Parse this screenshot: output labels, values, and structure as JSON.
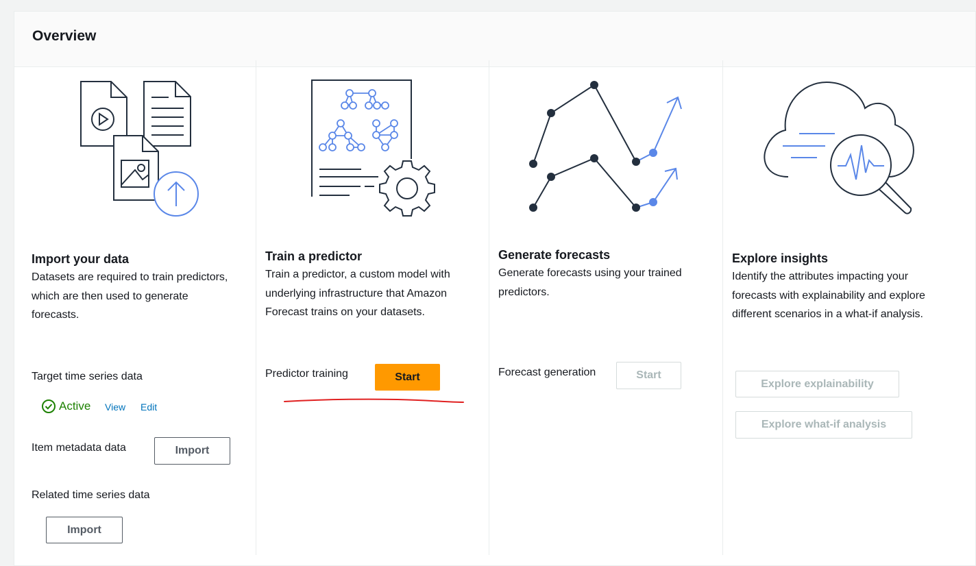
{
  "panel": {
    "title": "Overview"
  },
  "colors": {
    "accent_blue": "#5a87e8",
    "primary_orange": "#ff9900",
    "success_green": "#1d8102",
    "link_blue": "#0073bb",
    "annotation_red": "#e02020"
  },
  "cards": {
    "import": {
      "title": "Import your data",
      "desc": "Datasets are required to train predictors, which are then used to generate forecasts.",
      "target_label": "Target time series data",
      "target_status": "Active",
      "view_link": "View",
      "edit_link": "Edit",
      "item_label": "Item metadata data",
      "item_button": "Import",
      "related_label": "Related time series data",
      "related_button": "Import",
      "icons": [
        "video-file-icon",
        "document-icon",
        "image-file-icon",
        "upload-icon"
      ]
    },
    "train": {
      "title": "Train a predictor",
      "desc": "Train a predictor, a custom model with underlying infrastructure that Amazon Forecast trains on your datasets.",
      "action_label": "Predictor training",
      "action_button": "Start",
      "icons": [
        "model-document-icon",
        "gear-icon"
      ]
    },
    "forecast": {
      "title": "Generate forecasts",
      "desc": "Generate forecasts using your trained predictors.",
      "action_label": "Forecast generation",
      "action_button": "Start",
      "icons": [
        "line-chart-icon"
      ]
    },
    "insights": {
      "title": "Explore insights",
      "desc": "Identify the attributes impacting your forecasts with explainability and explore different scenarios in a what-if analysis.",
      "explainability_button": "Explore explainability",
      "whatif_button": "Explore what-if analysis",
      "icons": [
        "cloud-magnifier-icon"
      ]
    }
  }
}
